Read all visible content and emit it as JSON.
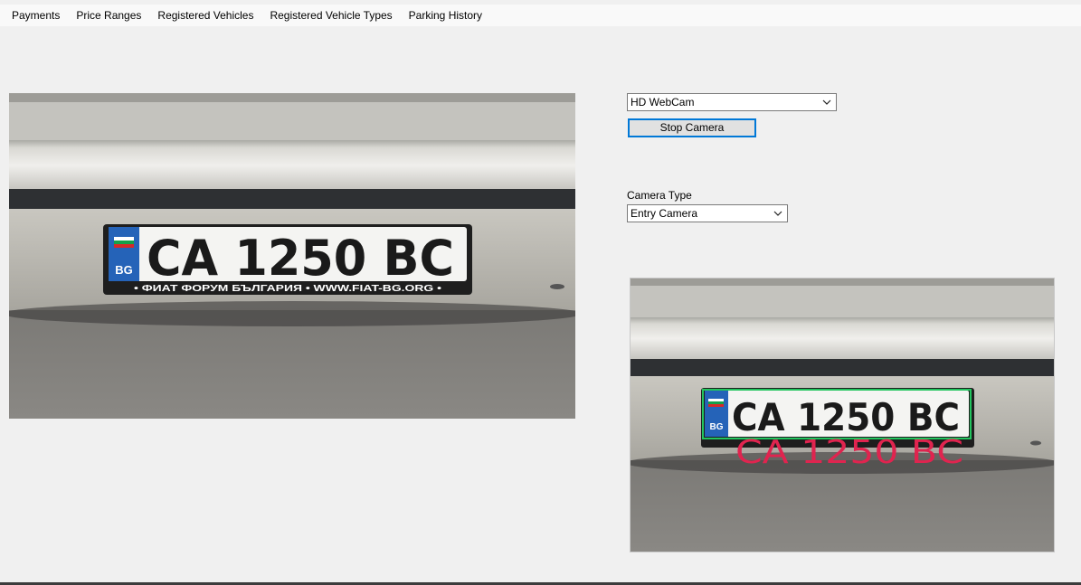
{
  "menu": {
    "items": [
      "Payments",
      "Price Ranges",
      "Registered Vehicles",
      "Registered Vehicle Types",
      "Parking History"
    ]
  },
  "camera_source": {
    "selected": "HD WebCam"
  },
  "stop_button": {
    "label": "Stop Camera"
  },
  "camera_type": {
    "label": "Camera Type",
    "selected": "Entry Camera"
  },
  "plate": {
    "country": "BG",
    "number": "CA 1250 BC",
    "frame_text": "• ФИАТ ФОРУМ БЪЛГАРИЯ • WWW.FIAT-BG.ORG •"
  },
  "recognition": {
    "text": "CA 1250 BC",
    "overlay_color": "#e0244f",
    "box_color": "#22c55e"
  }
}
